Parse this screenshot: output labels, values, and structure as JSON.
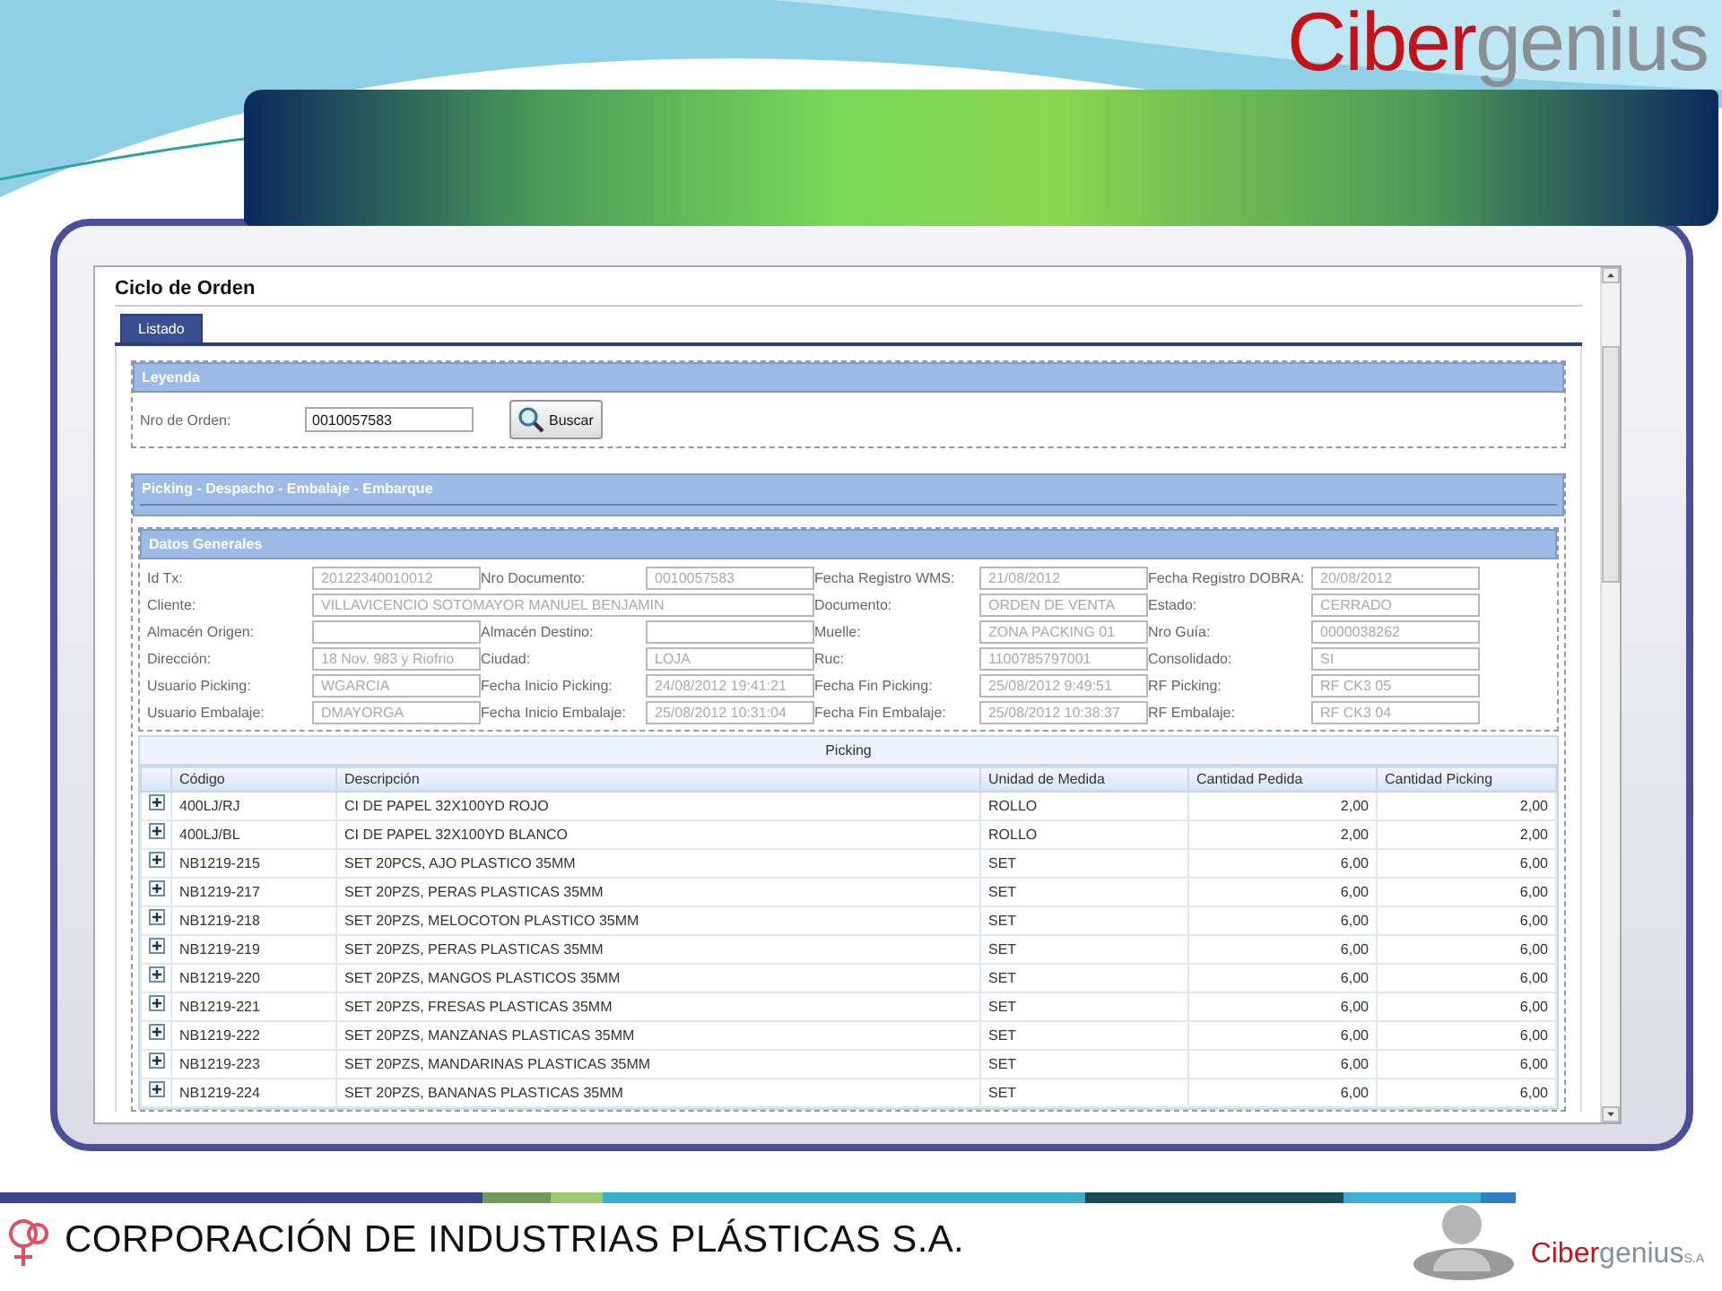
{
  "slide": {
    "logo": {
      "first": "Ciber",
      "second": "genius"
    }
  },
  "window": {
    "title": "Ciclo de Orden"
  },
  "tabs": [
    {
      "label": "Listado",
      "selected": true
    }
  ],
  "search": {
    "section": "Leyenda",
    "label": "Nro de Orden:",
    "value": "0010057583",
    "button": "Buscar"
  },
  "panel": {
    "title": "Picking - Despacho - Embalaje - Embarque"
  },
  "general": {
    "title": "Datos Generales",
    "fields": [
      {
        "label": "Id Tx:",
        "value": "20122340010012",
        "kind": "normal"
      },
      {
        "label": "Nro Documento:",
        "value": "0010057583",
        "kind": "normal"
      },
      {
        "label": "Fecha Registro WMS:",
        "value": "21/08/2012",
        "kind": "normal"
      },
      {
        "label": "Fecha Registro DOBRA:",
        "value": "20/08/2012",
        "kind": "normal"
      },
      {
        "label": "Cliente:",
        "value": "VILLAVICENCIO SOTOMAYOR MANUEL BENJAMIN",
        "kind": "wide"
      },
      {
        "label": "Documento:",
        "value": "ORDEN DE VENTA",
        "kind": "normal"
      },
      {
        "label": "Estado:",
        "value": "CERRADO",
        "kind": "normal"
      },
      {
        "label": "Almacén Origen:",
        "kind": "normal"
      },
      {
        "label": "Almacén Destino:",
        "kind": "normal"
      },
      {
        "label": "Muelle:",
        "value": "ZONA PACKING 01",
        "kind": "normal"
      },
      {
        "label": "Nro Guía:",
        "value": "0000038262",
        "kind": "normal"
      },
      {
        "label": "Dirección:",
        "value": "18 Nov. 983 y Riofrio",
        "kind": "normal"
      },
      {
        "label": "Ciudad:",
        "value": "LOJA",
        "kind": "normal"
      },
      {
        "label": "Ruc:",
        "value": "1100785797001",
        "kind": "normal"
      },
      {
        "label": "Consolidado:",
        "value": "SI",
        "kind": "normal"
      },
      {
        "label": "Usuario Picking:",
        "value": "WGARCIA",
        "kind": "normal"
      },
      {
        "label": "Fecha Inicio Picking:",
        "value": "24/08/2012 19:41:21",
        "kind": "normal"
      },
      {
        "label": "Fecha Fin Picking:",
        "value": "25/08/2012 9:49:51",
        "kind": "normal"
      },
      {
        "label": "RF Picking:",
        "value": "RF CK3 05",
        "kind": "normal"
      },
      {
        "label": "Usuario Embalaje:",
        "value": "DMAYORGA",
        "kind": "normal"
      },
      {
        "label": "Fecha Inicio Embalaje:",
        "value": "25/08/2012 10:31:04",
        "kind": "normal"
      },
      {
        "label": "Fecha Fin Embalaje:",
        "value": "25/08/2012 10:38:37",
        "kind": "normal"
      },
      {
        "label": "RF Embalaje:",
        "value": "RF CK3 04",
        "kind": "normal"
      }
    ]
  },
  "table": {
    "caption": "Picking",
    "columns": [
      "Código",
      "Descripción",
      "Unidad de Medida",
      "Cantidad Pedida",
      "Cantidad Picking"
    ],
    "rows": [
      [
        "400LJ/RJ",
        "CI DE PAPEL 32X100YD ROJO",
        "ROLLO",
        "2,00",
        "2,00"
      ],
      [
        "400LJ/BL",
        "CI DE PAPEL 32X100YD BLANCO",
        "ROLLO",
        "2,00",
        "2,00"
      ],
      [
        "NB1219-215",
        "SET 20PCS, AJO PLASTICO 35MM",
        "SET",
        "6,00",
        "6,00"
      ],
      [
        "NB1219-217",
        "SET 20PZS, PERAS PLASTICAS 35MM",
        "SET",
        "6,00",
        "6,00"
      ],
      [
        "NB1219-218",
        "SET 20PZS, MELOCOTON PLASTICO 35MM",
        "SET",
        "6,00",
        "6,00"
      ],
      [
        "NB1219-219",
        "SET 20PZS, PERAS PLASTICAS 35MM",
        "SET",
        "6,00",
        "6,00"
      ],
      [
        "NB1219-220",
        "SET 20PZS, MANGOS PLASTICOS 35MM",
        "SET",
        "6,00",
        "6,00"
      ],
      [
        "NB1219-221",
        "SET 20PZS, FRESAS PLASTICAS 35MM",
        "SET",
        "6,00",
        "6,00"
      ],
      [
        "NB1219-222",
        "SET 20PZS, MANZANAS PLASTICAS 35MM",
        "SET",
        "6,00",
        "6,00"
      ],
      [
        "NB1219-223",
        "SET 20PZS, MANDARINAS PLASTICAS 35MM",
        "SET",
        "6,00",
        "6,00"
      ],
      [
        "NB1219-224",
        "SET 20PZS, BANANAS PLASTICAS 35MM",
        "SET",
        "6,00",
        "6,00"
      ]
    ]
  },
  "footer": {
    "company": "CORPORACIÓN DE INDUSTRIAS PLÁSTICAS S.A.",
    "logo": {
      "first": "Ciber",
      "second": "genius",
      "suffix": "S.A"
    }
  }
}
